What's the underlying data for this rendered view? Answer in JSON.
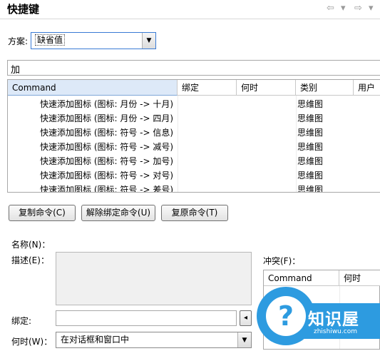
{
  "header": {
    "title": "快捷键",
    "back_icon": "⇦",
    "forward_icon": "⇨",
    "dropdown_icon": "▾"
  },
  "scheme": {
    "label": "方案:",
    "value": "缺省值"
  },
  "filter": {
    "value": "加"
  },
  "table": {
    "columns": [
      "Command",
      "绑定",
      "何时",
      "类别",
      "用户"
    ],
    "sort_indicator": "ˆ",
    "rows": [
      {
        "command": "快速添加图标 (图标: 月份 -> 十月)",
        "category": "思维图"
      },
      {
        "command": "快速添加图标 (图标: 月份 -> 四月)",
        "category": "思维图"
      },
      {
        "command": "快速添加图标 (图标: 符号 -> 信息)",
        "category": "思维图"
      },
      {
        "command": "快速添加图标 (图标: 符号 -> 减号)",
        "category": "思维图"
      },
      {
        "command": "快速添加图标 (图标: 符号 -> 加号)",
        "category": "思维图"
      },
      {
        "command": "快速添加图标 (图标: 符号 -> 对号)",
        "category": "思维图"
      },
      {
        "command": "快速添加图标 (图标: 符号 -> 差号)",
        "category": "思维图"
      }
    ]
  },
  "buttons": {
    "copy": "复制命令(C)",
    "unbind": "解除绑定命令(U)",
    "restore": "复原命令(T)"
  },
  "details": {
    "name_label": "名称(N)：",
    "desc_label": "描述(E)：",
    "binding_label": "绑定:",
    "when_label": "何时(W)：",
    "when_value": "在对话框和窗口中",
    "binding_btn": "◂"
  },
  "conflicts": {
    "label": "冲突(F)：",
    "columns": [
      "Command",
      "何时"
    ]
  },
  "watermark": {
    "brand": "知识屋",
    "site": "zhishiwu.com",
    "symbol": "?"
  }
}
